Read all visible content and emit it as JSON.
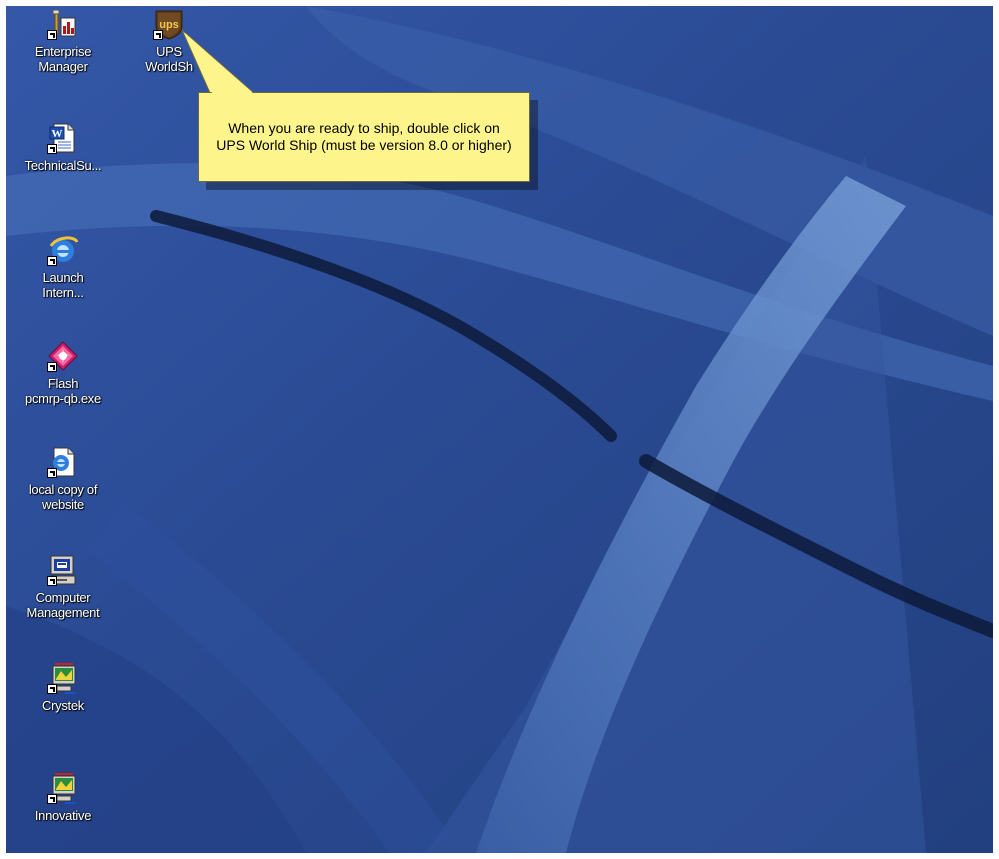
{
  "desktop": {
    "icons": [
      {
        "label_line1": "Enterprise",
        "label_line2": "Manager",
        "icon": "enterprise-manager-icon"
      },
      {
        "label_line1": "UPS",
        "label_line2": "WorldSh",
        "icon": "ups-icon"
      },
      {
        "label_line1": "TechnicalSu...",
        "label_line2": "",
        "icon": "word-document-icon"
      },
      {
        "label_line1": "Launch",
        "label_line2": "Intern...",
        "icon": "internet-explorer-icon"
      },
      {
        "label_line1": "Flash",
        "label_line2": "pcmrp-qb.exe",
        "icon": "flash-icon"
      },
      {
        "label_line1": "local copy of",
        "label_line2": "website",
        "icon": "html-document-icon"
      },
      {
        "label_line1": "Computer",
        "label_line2": "Management",
        "icon": "computer-management-icon"
      },
      {
        "label_line1": "Crystek",
        "label_line2": "",
        "icon": "crystek-icon"
      },
      {
        "label_line1": "Innovative",
        "label_line2": "",
        "icon": "innovative-icon"
      }
    ]
  },
  "callout": {
    "text": "When you are ready to ship, double click on UPS World Ship (must be version 8.0 or higher)"
  },
  "colors": {
    "wallpaper_base": "#2a4a93",
    "callout_fill": "#fdf58c"
  }
}
